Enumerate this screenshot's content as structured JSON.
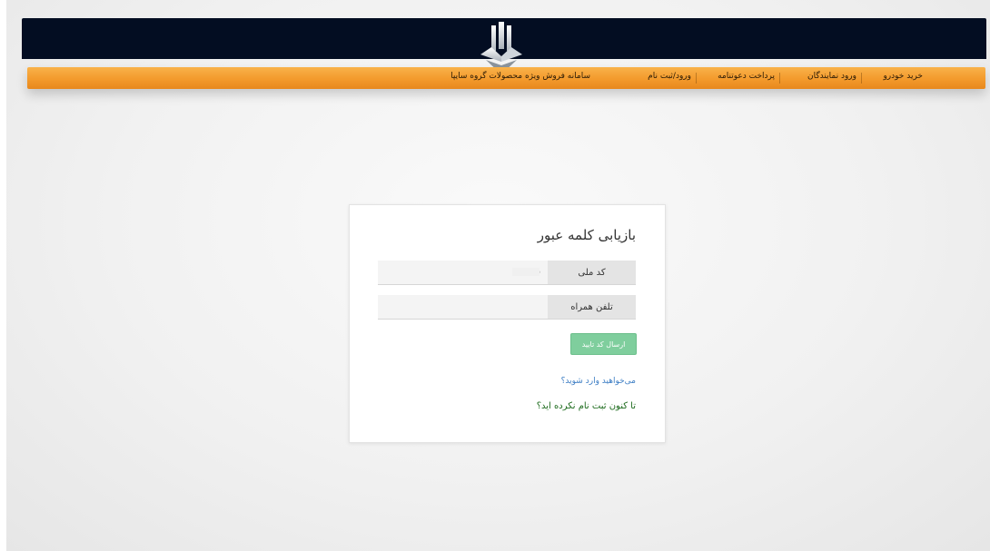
{
  "header": {
    "logo_name": "saipa-logo",
    "bg_color": "#030d22"
  },
  "nav": {
    "items": [
      {
        "label": "خرید خودرو"
      },
      {
        "label": "ورود نمایندگان"
      },
      {
        "label": "پرداخت دعوتنامه"
      },
      {
        "label": "ورود/ثبت نام"
      }
    ],
    "brand_text": "سامانه فروش ویژه محصولات گروه سایپا",
    "bg_color": "#f39a2c"
  },
  "form": {
    "title": "بازیابی کلمه عبور",
    "national_code": {
      "label": "کد ملی",
      "value": "006"
    },
    "mobile": {
      "label": "تلفن همراه",
      "value": ""
    },
    "submit_label": "ارسال کد تایید",
    "submit_color": "#7fce9d",
    "login_link": "می‌خواهید وارد شوید؟",
    "register_link": "تا کنون ثبت نام نکرده اید؟"
  }
}
